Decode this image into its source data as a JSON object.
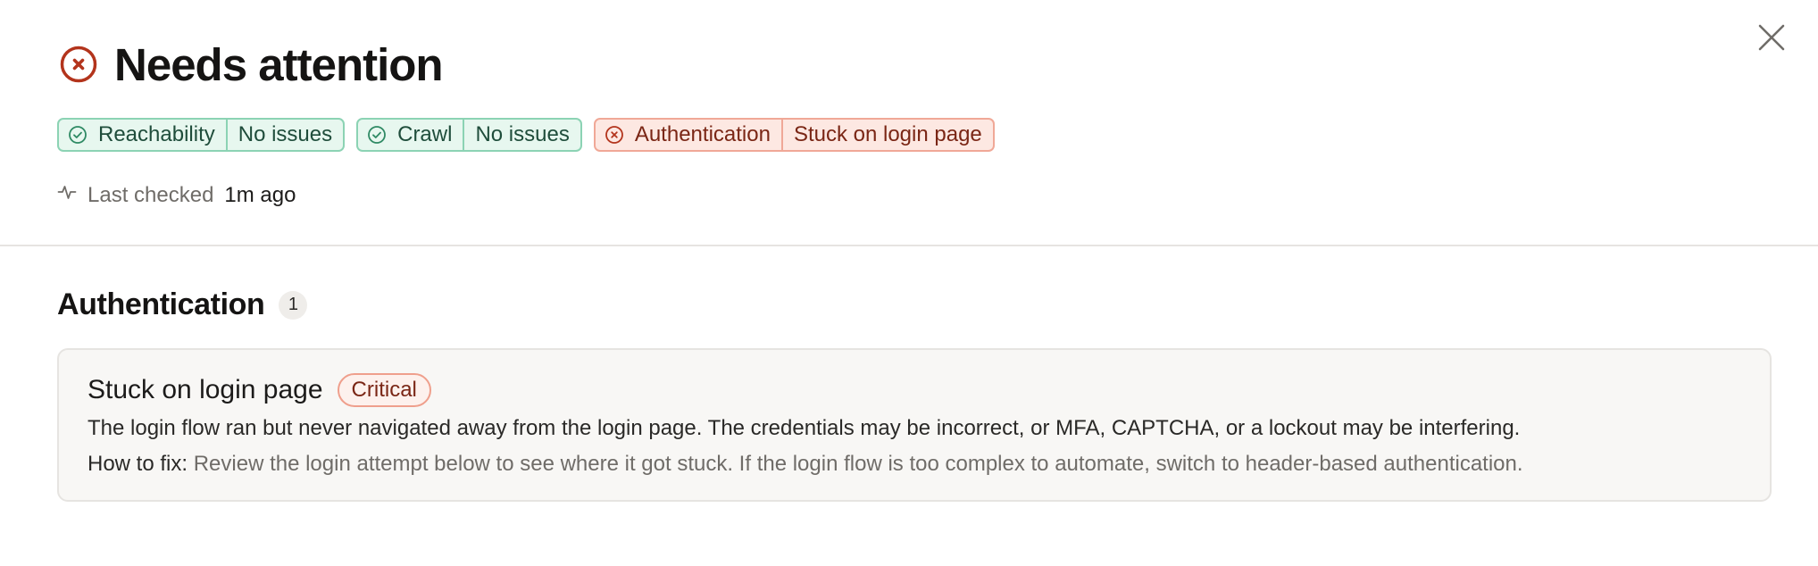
{
  "header": {
    "title": "Needs attention",
    "status": "error",
    "close_label": "Close"
  },
  "badges": [
    {
      "status": "ok",
      "name": "Reachability",
      "value": "No issues"
    },
    {
      "status": "ok",
      "name": "Crawl",
      "value": "No issues"
    },
    {
      "status": "error",
      "name": "Authentication",
      "value": "Stuck on login page"
    }
  ],
  "last_checked": {
    "label": "Last checked",
    "value": "1m ago"
  },
  "section": {
    "title": "Authentication",
    "count": "1"
  },
  "issue": {
    "title": "Stuck on login page",
    "severity": "Critical",
    "description": "The login flow ran but never navigated away from the login page. The credentials may be incorrect, or MFA, CAPTCHA, or a lockout may be interfering.",
    "fix_label": "How to fix:",
    "fix_text": "Review the login attempt below to see where it got stuck. If the login flow is too complex to automate, switch to header-based authentication."
  },
  "colors": {
    "error": "#b3341c",
    "ok": "#2f8a64",
    "divider": "#e6e4e1",
    "card_bg": "#f8f7f5"
  },
  "icons": {
    "title": "x-circle-icon",
    "close": "close-icon",
    "ok_badge": "check-circle-icon",
    "error_badge": "x-circle-icon",
    "last_checked": "activity-pulse-icon"
  }
}
